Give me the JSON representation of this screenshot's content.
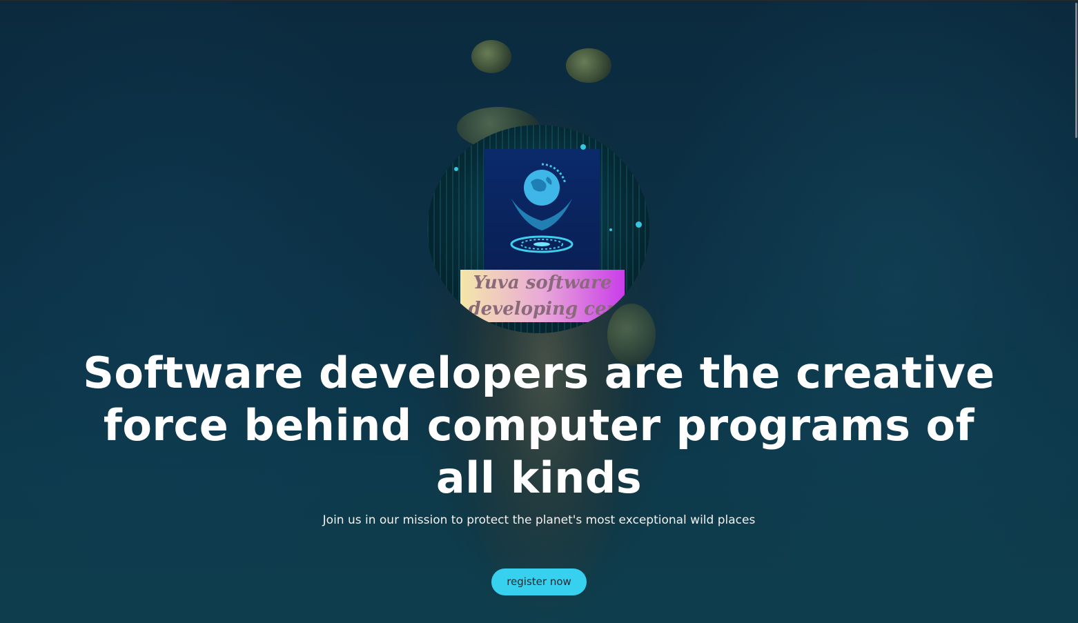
{
  "hero": {
    "logo": {
      "name": "logo-image",
      "banner_line1": "Yuva software",
      "banner_line2": "developing cent"
    },
    "headline": "Software developers are the creative force behind computer programs of all kinds",
    "subheadline": "Join us in our mission to protect the planet's most exceptional wild places",
    "cta_label": "register now"
  },
  "colors": {
    "accent": "#38d0ef",
    "ocean": "#0c3146",
    "text": "#ffffff"
  }
}
